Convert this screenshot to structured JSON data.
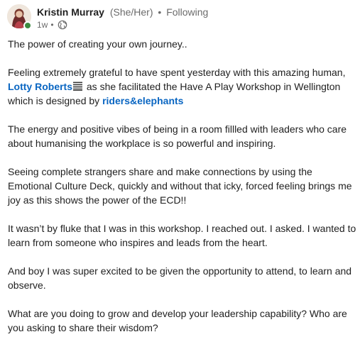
{
  "author": {
    "name": "Kristin Murray",
    "pronouns": "(She/Her)",
    "separator": "•",
    "follow_state": "Following",
    "time_ago": "1w",
    "visibility_icon": "globe-icon",
    "avatar_icon": "avatar",
    "online": true
  },
  "post": {
    "p1": "The power of creating your own journey..",
    "p2_before": "Feeling extremely grateful to have spent yesterday with this amazing human, ",
    "p2_mention1": "Lotty Roberts",
    "p2_flag_icon": "flag-icon",
    "p2_middle": " as she facilitated the Have A Play Workshop in Wellington which is designed by ",
    "p2_mention2": "riders&elephants",
    "p3": "The energy and positive vibes of being in a room fillled with leaders who care about humanising the workplace is so powerful and inspiring.",
    "p4": "Seeing complete strangers share and make connections by using the Emotional Culture Deck, quickly and without that icky, forced feeling brings me joy as this shows the power of the ECD!!",
    "p5": "It wasn’t by fluke that I was in this workshop. I reached out. I asked. I wanted to learn from someone who inspires and leads from the heart.",
    "p6": "And boy I was super excited to be given the opportunity to attend, to learn and observe.",
    "p7": "What are you doing to grow and develop your leadership capability? Who are you asking to share their wisdom?"
  },
  "colors": {
    "link": "#0a66c2",
    "text": "#1f1f1f",
    "muted": "#6b6b6b",
    "online": "#3c8a3f"
  }
}
